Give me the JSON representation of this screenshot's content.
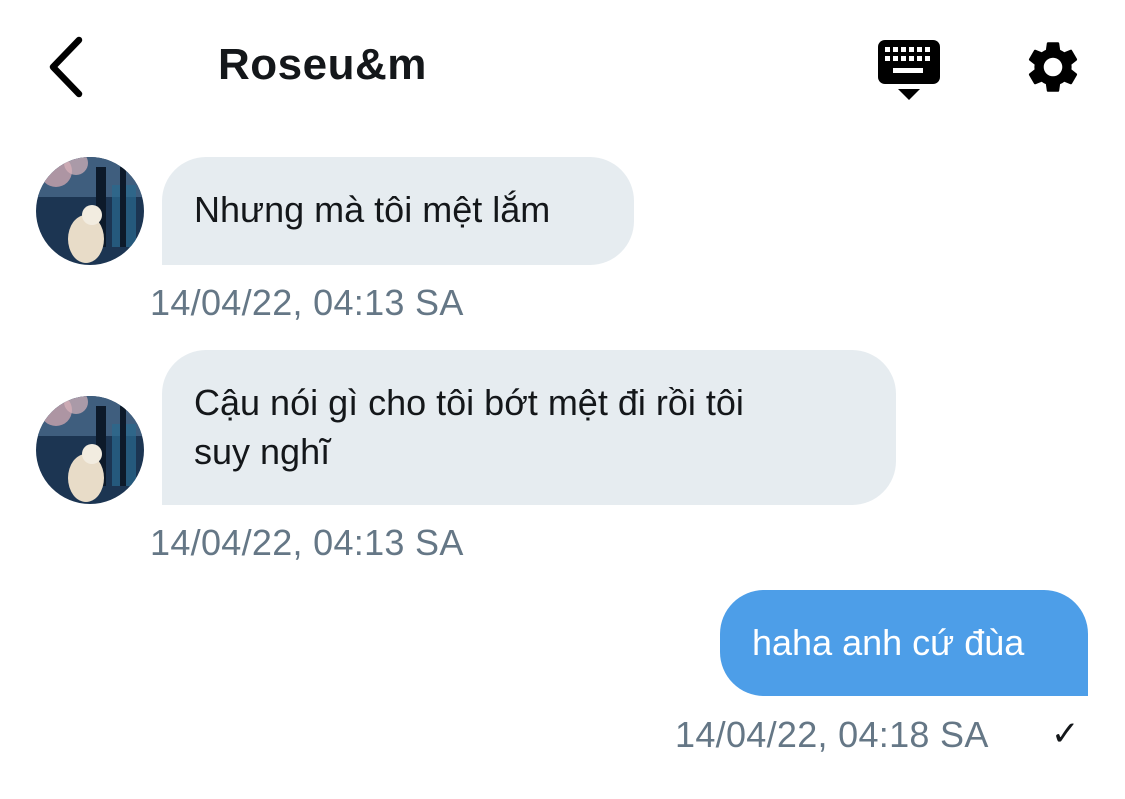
{
  "header": {
    "title": "Roseu&m",
    "back_icon": "chevron-left-icon",
    "keyboard_icon": "keyboard-icon",
    "settings_icon": "gear-icon"
  },
  "messages": [
    {
      "direction": "incoming",
      "lines": [
        "Nhưng mà tôi mệt lắm"
      ],
      "timestamp": "14/04/22, 04:13 SA"
    },
    {
      "direction": "incoming",
      "lines": [
        "Cậu nói gì cho tôi bớt mệt đi rồi tôi",
        "suy nghĩ"
      ],
      "timestamp": "14/04/22, 04:13 SA"
    },
    {
      "direction": "outgoing",
      "lines": [
        "haha anh cứ đùa"
      ],
      "timestamp": "14/04/22, 04:18 SA",
      "status": "✓"
    }
  ],
  "colors": {
    "incoming_bubble": "#e6ecf0",
    "outgoing_bubble": "#4d9ee8",
    "timestamp": "#657786",
    "text": "#14171a"
  }
}
